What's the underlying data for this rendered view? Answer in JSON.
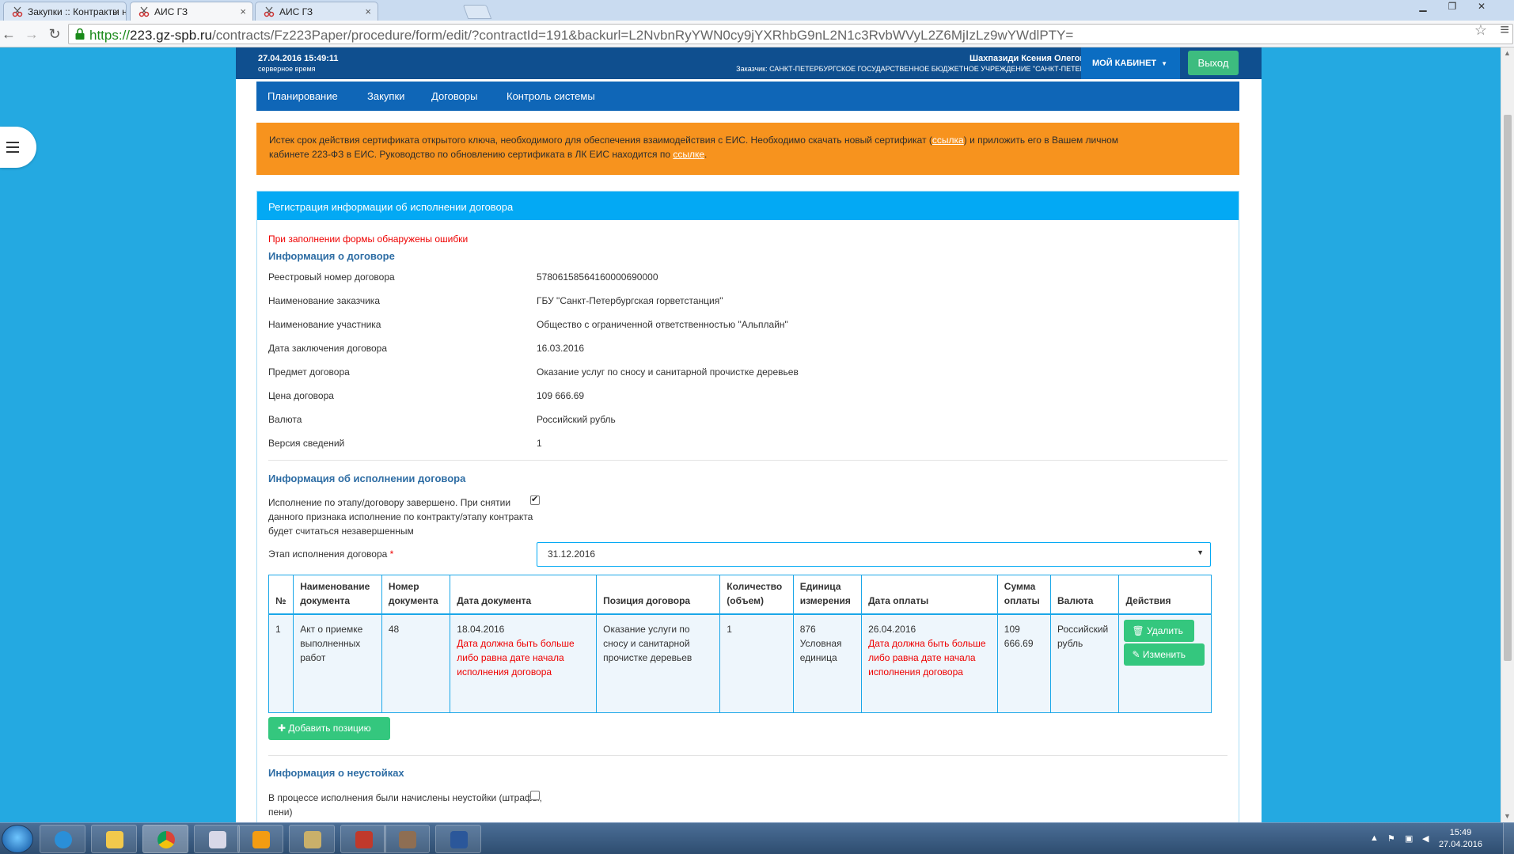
{
  "browser": {
    "tabs": [
      {
        "title": "Закупки :: Контракты на",
        "active": false
      },
      {
        "title": "АИС ГЗ",
        "active": true
      },
      {
        "title": "АИС ГЗ",
        "active": false
      }
    ],
    "url_proto": "https://",
    "url_host": "223.gz-spb.ru",
    "url_path": "/contracts/Fz223Paper/procedure/form/edit/?contractId=191&backurl=L2NvbnRyYWN0cy9jYXRhbG9nL2N1c3RvbWVyL2Z6MjIzLz9wYWdlPTY="
  },
  "header": {
    "server_time": "27.04.2016 15:49:11",
    "server_time_label": "серверное время",
    "user_name": "Шахпазиди Ксения Олеговна",
    "user_org": "Заказчик: САНКТ-ПЕТЕРБУРГСКОЕ ГОСУДАРСТВЕННОЕ БЮДЖЕТНОЕ УЧРЕЖДЕНИЕ \"САНКТ-ПЕТЕРБ...",
    "cabinet_label": "МОЙ КАБИНЕТ",
    "logout_label": "Выход"
  },
  "nav": [
    "Планирование",
    "Закупки",
    "Договоры",
    "Контроль системы"
  ],
  "alert": {
    "text1": "Истек срок действия сертификата открытого ключа, необходимого для обеспечения взаимодействия с ЕИС. Необходимо скачать новый сертификат (",
    "link1": "ссылка",
    "text2": ") и приложить его в Вашем личном",
    "text3": "кабинете 223-ФЗ в ЕИС. Руководство по обновлению сертификата в ЛК ЕИС находится по ",
    "link2": "ссылке",
    "text4": "."
  },
  "form": {
    "title": "Регистрация информации об исполнении договора",
    "error": "При заполнении формы обнаружены ошибки",
    "contract_section": "Информация о договоре",
    "fields": [
      {
        "label": "Реестровый номер договора",
        "value": "57806158564160000690000"
      },
      {
        "label": "Наименование заказчика",
        "value": "ГБУ \"Санкт-Петербургская горветстанция\""
      },
      {
        "label": "Наименование участника",
        "value": "Общество с ограниченной ответственностью \"Альплайн\""
      },
      {
        "label": "Дата заключения договора",
        "value": "16.03.2016"
      },
      {
        "label": "Предмет договора",
        "value": "Оказание услуг по сносу и санитарной прочистке деревьев"
      },
      {
        "label": "Цена договора",
        "value": "109 666.69"
      },
      {
        "label": "Валюта",
        "value": "Российский рубль"
      },
      {
        "label": "Версия сведений",
        "value": "1"
      }
    ],
    "execution_section": "Информация об исполнении договора",
    "completed_label_1": "Исполнение по этапу/договору завершено. При снятии",
    "completed_label_2": "данного признака исполнение по контракту/этапу контракта",
    "completed_label_3": "будет считаться незавершенным",
    "completed_checked": true,
    "stage_label": "Этап исполнения договора",
    "stage_required": "*",
    "stage_value": "31.12.2016",
    "table": {
      "headers": [
        "№",
        "Наименование документа",
        "Номер документа",
        "Дата документа",
        "Позиция договора",
        "Количество (объем)",
        "Единица измерения",
        "Дата оплаты",
        "Сумма оплаты",
        "Валюта",
        "Действия"
      ],
      "rows": [
        {
          "num": "1",
          "doc_name": "Акт о приемке выполненных работ",
          "doc_number": "48",
          "doc_date": "18.04.2016",
          "doc_date_error": "Дата должна быть больше либо равна дате начала исполнения договора",
          "position": "Оказание услуги по сносу и санитарной прочистке деревьев",
          "quantity": "1",
          "unit": "876 Условная единица",
          "pay_date": "26.04.2016",
          "pay_date_error": "Дата должна быть больше либо равна дате начала исполнения договора",
          "amount": "109 666.69",
          "currency": "Российский рубль",
          "delete_label": "Удалить",
          "edit_label": "Изменить"
        }
      ]
    },
    "add_position_label": "Добавить позицию",
    "penalty_section": "Информация о неустойках",
    "penalty_label_1": "В процессе исполнения были начислены неустойки (штрафы,",
    "penalty_label_2": "пени)",
    "penalty_checked": false
  },
  "taskbar": {
    "time": "15:49",
    "date": "27.04.2016"
  },
  "colors": {
    "page_bg": "#24a9e1",
    "header_bg": "#0f4f8f",
    "nav_bg": "#0f66b7",
    "alert_bg": "#f7931e",
    "panel_head": "#03a9f4",
    "green_button": "#34c77e",
    "error_text": "#ee0000"
  }
}
